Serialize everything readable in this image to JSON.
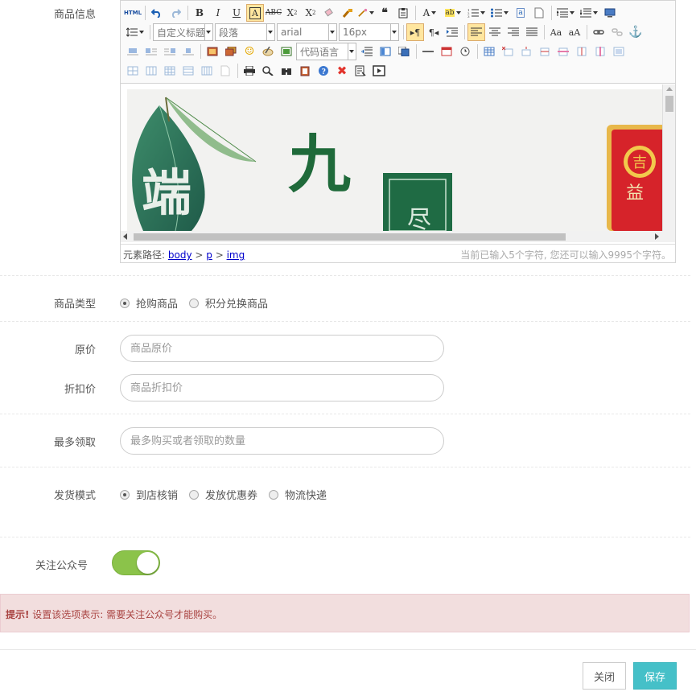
{
  "form": {
    "goods_info_label": "商品信息",
    "goods_type_label": "商品类型",
    "goods_type_options": [
      "抢购商品",
      "积分兑换商品"
    ],
    "goods_type_selected": "抢购商品",
    "original_price_label": "原价",
    "original_price_placeholder": "商品原价",
    "discount_price_label": "折扣价",
    "discount_price_placeholder": "商品折扣价",
    "max_claim_label": "最多领取",
    "max_claim_placeholder": "最多购买或者领取的数量",
    "delivery_label": "发货模式",
    "delivery_options": [
      "到店核销",
      "发放优惠券",
      "物流快递"
    ],
    "delivery_selected": "到店核销",
    "follow_label": "关注公众号",
    "follow_enabled": true
  },
  "editor": {
    "html_btn": "HTML",
    "heading_select": "自定义标题",
    "paragraph_select": "段落",
    "font_select": "arial",
    "size_select": "16px",
    "code_lang_select": "代码语言",
    "path_label": "元素路径:",
    "path": [
      "body",
      "p",
      "img"
    ],
    "char_count": "当前已输入5个字符, 您还可以输入9995个字符。"
  },
  "banner": {
    "text_big": "九",
    "text_side": "端",
    "text_box": "尽",
    "text_logo": "益"
  },
  "alert": {
    "strong": "提示!",
    "message": " 设置该选项表示: 需要关注公众号才能购买。"
  },
  "buttons": {
    "close": "关闭",
    "save": "保存"
  },
  "colors": {
    "switch_on": "#8bc34a",
    "save_btn": "#45c0c8",
    "alert_bg": "#f2dede",
    "alert_text": "#a94442"
  }
}
